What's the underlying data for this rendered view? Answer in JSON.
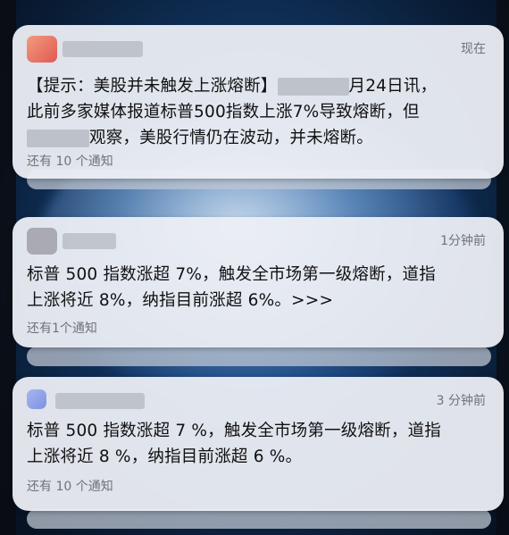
{
  "notifications": [
    {
      "time": "现在",
      "text_part1": "【提示：美股并未触发上涨熔断】",
      "text_part2": "月24日讯，",
      "text_line2": "此前多家媒体报道标普500指数上涨7%导致熔断，但",
      "text_line3": "观察，美股行情仍在波动，并未熔断。",
      "more": "还有 10 个通知"
    },
    {
      "time": "1分钟前",
      "text_line1": "标普 500 指数涨超 7%，触发全市场第一级熔断，道指",
      "text_line2": "上涨将近 8%，纳指目前涨超 6%。>>>",
      "more": "还有1个通知"
    },
    {
      "time": "3 分钟前",
      "text_line1": "标普 500 指数涨超 7 %，触发全市场第一级熔断，道指",
      "text_line2": "上涨将近 8 %，纳指目前涨超 6 %。",
      "more": "还有 10 个通知"
    }
  ],
  "colors": {
    "card_bg": "#ecedf2",
    "secondary_text": "#6f7278",
    "primary_text": "#111111",
    "icon1": "#e8766a",
    "icon2": "#a9aab3",
    "icon3": "#8fa2e6"
  }
}
